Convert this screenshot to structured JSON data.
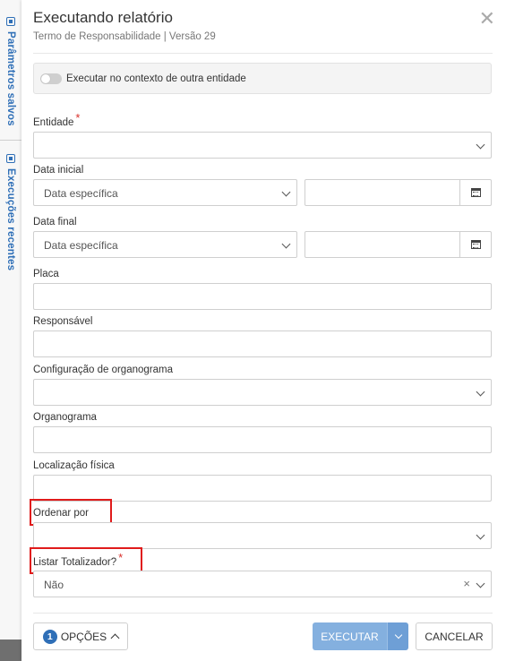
{
  "side": {
    "saved_params": "Parâmetros salvos",
    "recent_runs": "Execuções recentes"
  },
  "dialog": {
    "title": "Executando relatório",
    "subtitle": "Termo de Responsabilidade | Versão 29",
    "context_toggle_label": "Executar no contexto de outra entidade",
    "context_toggle_on": false
  },
  "fields": {
    "entidade": {
      "label": "Entidade",
      "required_mark": "*",
      "value": ""
    },
    "data_inicial": {
      "label": "Data inicial",
      "mode": "Data específica",
      "date": ""
    },
    "data_final": {
      "label": "Data final",
      "mode": "Data específica",
      "date": ""
    },
    "placa": {
      "label": "Placa",
      "value": ""
    },
    "responsavel": {
      "label": "Responsável",
      "value": ""
    },
    "config_organograma": {
      "label": "Configuração de organograma",
      "value": ""
    },
    "organograma": {
      "label": "Organograma",
      "value": ""
    },
    "localizacao": {
      "label": "Localização física",
      "value": ""
    },
    "ordenar_por": {
      "label": "Ordenar por",
      "value": ""
    },
    "listar_totalizador": {
      "label": "Listar Totalizador?",
      "required_mark": "*",
      "value": "Não",
      "clear": "×"
    }
  },
  "footer": {
    "options_count": "1",
    "options_label": "OPÇÕES",
    "execute_label": "EXECUTAR",
    "cancel_label": "CANCELAR"
  },
  "colors": {
    "accent": "#2f6fb7",
    "execute_bg": "#84b0df",
    "highlight": "#e01b1b",
    "required": "#d9302b"
  }
}
